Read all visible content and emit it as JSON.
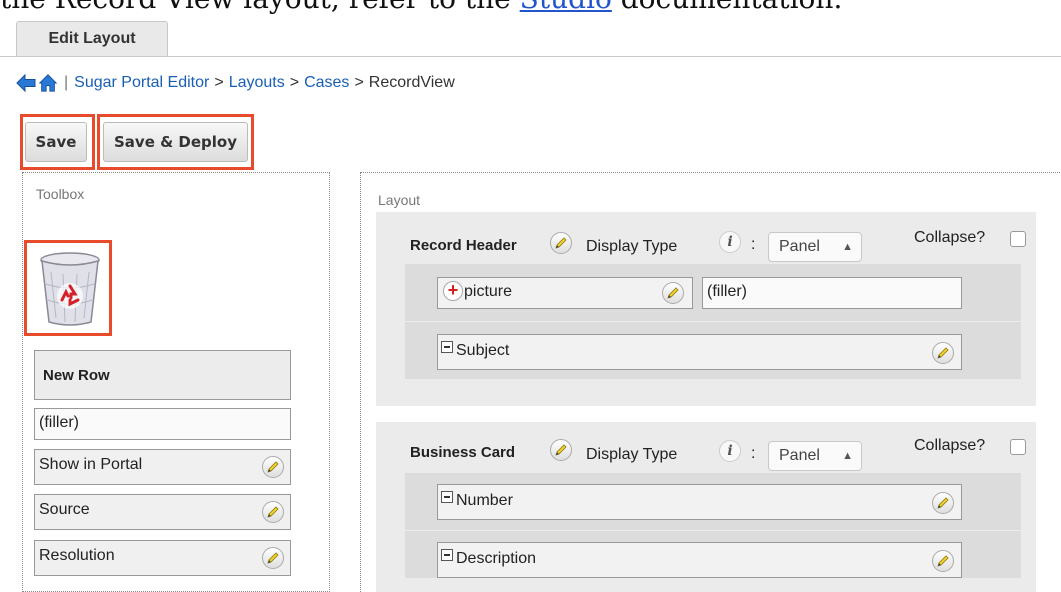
{
  "doc": {
    "text_before": "the Record View layout, refer to the ",
    "link_text": "Studio",
    "text_after": " documentation."
  },
  "tab": {
    "label": "Edit Layout"
  },
  "breadcrumb": {
    "separator": "|",
    "items": [
      "Sugar Portal Editor",
      "Layouts",
      "Cases"
    ],
    "current": "RecordView",
    "gt": ">"
  },
  "toolbar": {
    "save_label": "Save",
    "save_deploy_label": "Save & Deploy"
  },
  "toolbox": {
    "title": "Toolbox",
    "trash_icon": "recycle-bin-icon",
    "new_row_label": "New Row",
    "filler_label": "(filler)",
    "fields": [
      "Show in Portal",
      "Source",
      "Resolution"
    ]
  },
  "layout": {
    "title": "Layout",
    "display_type_label": "Display Type",
    "colon": ":",
    "collapse_label": "Collapse?",
    "panels": [
      {
        "name": "Record Header",
        "display_type": "Panel",
        "row1": {
          "field": "picture",
          "filler": "(filler)"
        },
        "row2": {
          "field": "Subject"
        }
      },
      {
        "name": "Business Card",
        "display_type": "Panel",
        "row1": {
          "field": "Number"
        },
        "row2": {
          "field": "Description"
        }
      }
    ]
  },
  "colors": {
    "highlight": "#e74b2b",
    "link": "#1a5fb4",
    "panel_bg": "#ebebeb",
    "row_bg": "#dcdcdc"
  }
}
